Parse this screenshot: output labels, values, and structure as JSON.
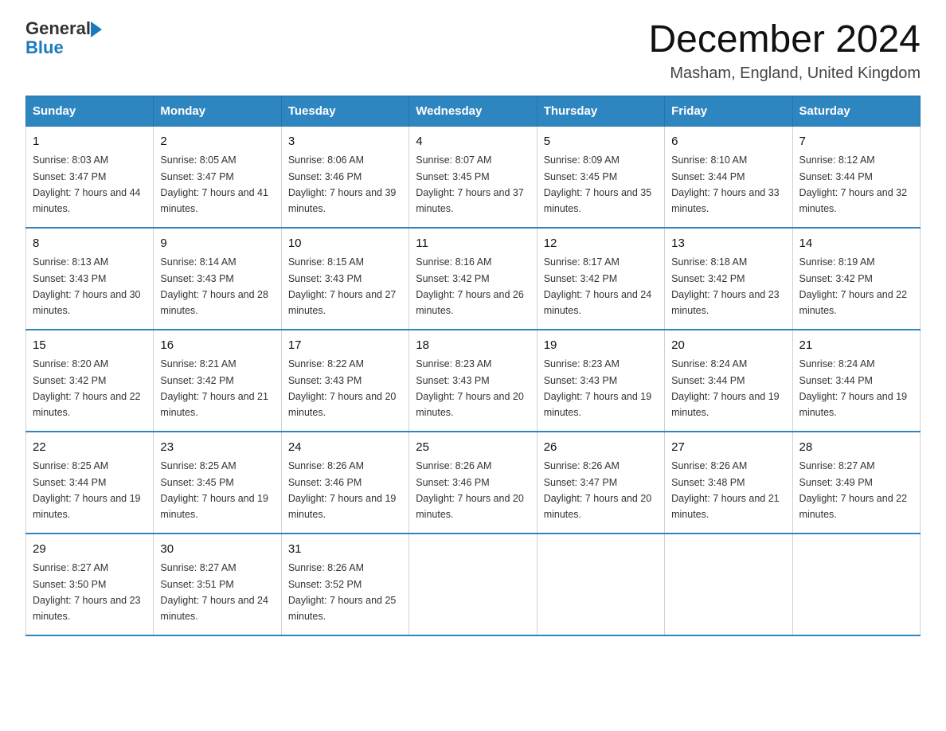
{
  "logo": {
    "text_general": "General",
    "text_blue": "Blue",
    "triangle": "▶"
  },
  "title": "December 2024",
  "subtitle": "Masham, England, United Kingdom",
  "days_of_week": [
    "Sunday",
    "Monday",
    "Tuesday",
    "Wednesday",
    "Thursday",
    "Friday",
    "Saturday"
  ],
  "weeks": [
    [
      {
        "day": "1",
        "sunrise": "8:03 AM",
        "sunset": "3:47 PM",
        "daylight": "7 hours and 44 minutes."
      },
      {
        "day": "2",
        "sunrise": "8:05 AM",
        "sunset": "3:47 PM",
        "daylight": "7 hours and 41 minutes."
      },
      {
        "day": "3",
        "sunrise": "8:06 AM",
        "sunset": "3:46 PM",
        "daylight": "7 hours and 39 minutes."
      },
      {
        "day": "4",
        "sunrise": "8:07 AM",
        "sunset": "3:45 PM",
        "daylight": "7 hours and 37 minutes."
      },
      {
        "day": "5",
        "sunrise": "8:09 AM",
        "sunset": "3:45 PM",
        "daylight": "7 hours and 35 minutes."
      },
      {
        "day": "6",
        "sunrise": "8:10 AM",
        "sunset": "3:44 PM",
        "daylight": "7 hours and 33 minutes."
      },
      {
        "day": "7",
        "sunrise": "8:12 AM",
        "sunset": "3:44 PM",
        "daylight": "7 hours and 32 minutes."
      }
    ],
    [
      {
        "day": "8",
        "sunrise": "8:13 AM",
        "sunset": "3:43 PM",
        "daylight": "7 hours and 30 minutes."
      },
      {
        "day": "9",
        "sunrise": "8:14 AM",
        "sunset": "3:43 PM",
        "daylight": "7 hours and 28 minutes."
      },
      {
        "day": "10",
        "sunrise": "8:15 AM",
        "sunset": "3:43 PM",
        "daylight": "7 hours and 27 minutes."
      },
      {
        "day": "11",
        "sunrise": "8:16 AM",
        "sunset": "3:42 PM",
        "daylight": "7 hours and 26 minutes."
      },
      {
        "day": "12",
        "sunrise": "8:17 AM",
        "sunset": "3:42 PM",
        "daylight": "7 hours and 24 minutes."
      },
      {
        "day": "13",
        "sunrise": "8:18 AM",
        "sunset": "3:42 PM",
        "daylight": "7 hours and 23 minutes."
      },
      {
        "day": "14",
        "sunrise": "8:19 AM",
        "sunset": "3:42 PM",
        "daylight": "7 hours and 22 minutes."
      }
    ],
    [
      {
        "day": "15",
        "sunrise": "8:20 AM",
        "sunset": "3:42 PM",
        "daylight": "7 hours and 22 minutes."
      },
      {
        "day": "16",
        "sunrise": "8:21 AM",
        "sunset": "3:42 PM",
        "daylight": "7 hours and 21 minutes."
      },
      {
        "day": "17",
        "sunrise": "8:22 AM",
        "sunset": "3:43 PM",
        "daylight": "7 hours and 20 minutes."
      },
      {
        "day": "18",
        "sunrise": "8:23 AM",
        "sunset": "3:43 PM",
        "daylight": "7 hours and 20 minutes."
      },
      {
        "day": "19",
        "sunrise": "8:23 AM",
        "sunset": "3:43 PM",
        "daylight": "7 hours and 19 minutes."
      },
      {
        "day": "20",
        "sunrise": "8:24 AM",
        "sunset": "3:44 PM",
        "daylight": "7 hours and 19 minutes."
      },
      {
        "day": "21",
        "sunrise": "8:24 AM",
        "sunset": "3:44 PM",
        "daylight": "7 hours and 19 minutes."
      }
    ],
    [
      {
        "day": "22",
        "sunrise": "8:25 AM",
        "sunset": "3:44 PM",
        "daylight": "7 hours and 19 minutes."
      },
      {
        "day": "23",
        "sunrise": "8:25 AM",
        "sunset": "3:45 PM",
        "daylight": "7 hours and 19 minutes."
      },
      {
        "day": "24",
        "sunrise": "8:26 AM",
        "sunset": "3:46 PM",
        "daylight": "7 hours and 19 minutes."
      },
      {
        "day": "25",
        "sunrise": "8:26 AM",
        "sunset": "3:46 PM",
        "daylight": "7 hours and 20 minutes."
      },
      {
        "day": "26",
        "sunrise": "8:26 AM",
        "sunset": "3:47 PM",
        "daylight": "7 hours and 20 minutes."
      },
      {
        "day": "27",
        "sunrise": "8:26 AM",
        "sunset": "3:48 PM",
        "daylight": "7 hours and 21 minutes."
      },
      {
        "day": "28",
        "sunrise": "8:27 AM",
        "sunset": "3:49 PM",
        "daylight": "7 hours and 22 minutes."
      }
    ],
    [
      {
        "day": "29",
        "sunrise": "8:27 AM",
        "sunset": "3:50 PM",
        "daylight": "7 hours and 23 minutes."
      },
      {
        "day": "30",
        "sunrise": "8:27 AM",
        "sunset": "3:51 PM",
        "daylight": "7 hours and 24 minutes."
      },
      {
        "day": "31",
        "sunrise": "8:26 AM",
        "sunset": "3:52 PM",
        "daylight": "7 hours and 25 minutes."
      },
      null,
      null,
      null,
      null
    ]
  ],
  "labels": {
    "sunrise_prefix": "Sunrise: ",
    "sunset_prefix": "Sunset: ",
    "daylight_prefix": "Daylight: "
  }
}
